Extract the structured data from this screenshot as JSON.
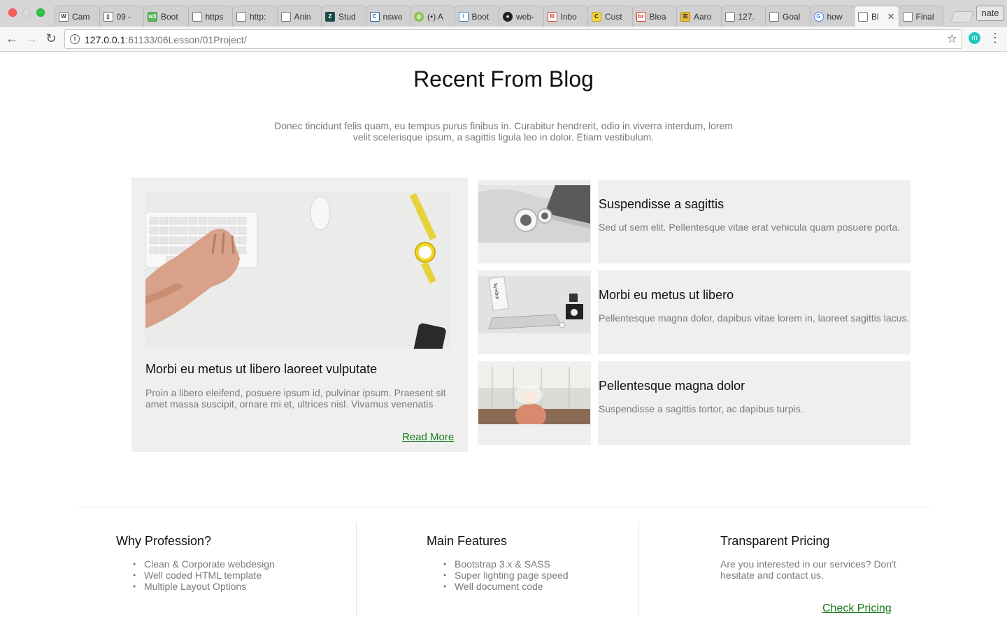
{
  "browser": {
    "tabs": [
      {
        "label": "Cam",
        "icon": "W"
      },
      {
        "label": "09 -",
        "icon": "▯"
      },
      {
        "label": "Boot",
        "icon": "w3"
      },
      {
        "label": "https",
        "icon": ""
      },
      {
        "label": "http:",
        "icon": ""
      },
      {
        "label": "Anin",
        "icon": ""
      },
      {
        "label": "Stud",
        "icon": "Z"
      },
      {
        "label": "nswe",
        "icon": "C"
      },
      {
        "label": "(•) A",
        "icon": "◎"
      },
      {
        "label": "Boot",
        "icon": "\\"
      },
      {
        "label": "web-",
        "icon": "●"
      },
      {
        "label": "Inbo",
        "icon": "M"
      },
      {
        "label": "Cust",
        "icon": "C"
      },
      {
        "label": "Blea",
        "icon": "br"
      },
      {
        "label": "Aaro",
        "icon": "☰"
      },
      {
        "label": "127.",
        "icon": ""
      },
      {
        "label": "Goal",
        "icon": ""
      },
      {
        "label": "how",
        "icon": "G"
      },
      {
        "label": "Bl",
        "icon": "",
        "active": true
      },
      {
        "label": "Final",
        "icon": ""
      }
    ],
    "profile_name": "nate",
    "url_host": "127.0.0.1",
    "url_path": ":61133/06Lesson/01Project/",
    "extension_letter": "m"
  },
  "blog": {
    "title": "Recent From Blog",
    "intro": "Donec tincidunt felis quam, eu tempus purus finibus in. Curabitur hendrerit, odio in viverra interdum, lorem velit scelerisque ipsum, a sagittis ligula leo in dolor. Etiam vestibulum.",
    "featured": {
      "title": "Morbi eu metus ut libero laoreet vulputate",
      "excerpt": "Proin a libero eleifend, posuere ipsum id, pulvinar ipsum. Praesent sit amet massa suscipit, ornare mi et, ultrices nisl. Vivamus venenatis",
      "read_more": "Read More"
    },
    "posts": [
      {
        "title": "Suspendisse a sagittis",
        "excerpt": "Sed ut sem elit. Pellentesque vitae erat vehicula quam posuere porta."
      },
      {
        "title": "Morbi eu metus ut libero",
        "excerpt": "Pellentesque magna dolor, dapibus vitae lorem in, laoreet sagittis lacus."
      },
      {
        "title": "Pellentesque magna dolor",
        "excerpt": "Suspendisse a sagittis tortor, ac dapibus turpis."
      }
    ]
  },
  "features": {
    "why": {
      "title": "Why Profession?",
      "items": [
        "Clean & Corporate webdesign",
        "Well coded HTML template",
        "Multiple Layout Options"
      ]
    },
    "main": {
      "title": "Main Features",
      "items": [
        "Bootstrap 3.x & SASS",
        "Super lighting page speed",
        "Well document code"
      ]
    },
    "pricing": {
      "title": "Transparent Pricing",
      "text": "Are you interested in our services? Don't hesitate and contact us.",
      "link": "Check Pricing"
    }
  },
  "colors": {
    "card_bg": "#efefef",
    "muted_text": "#7a7a7a",
    "link": "#1a7a1a"
  }
}
